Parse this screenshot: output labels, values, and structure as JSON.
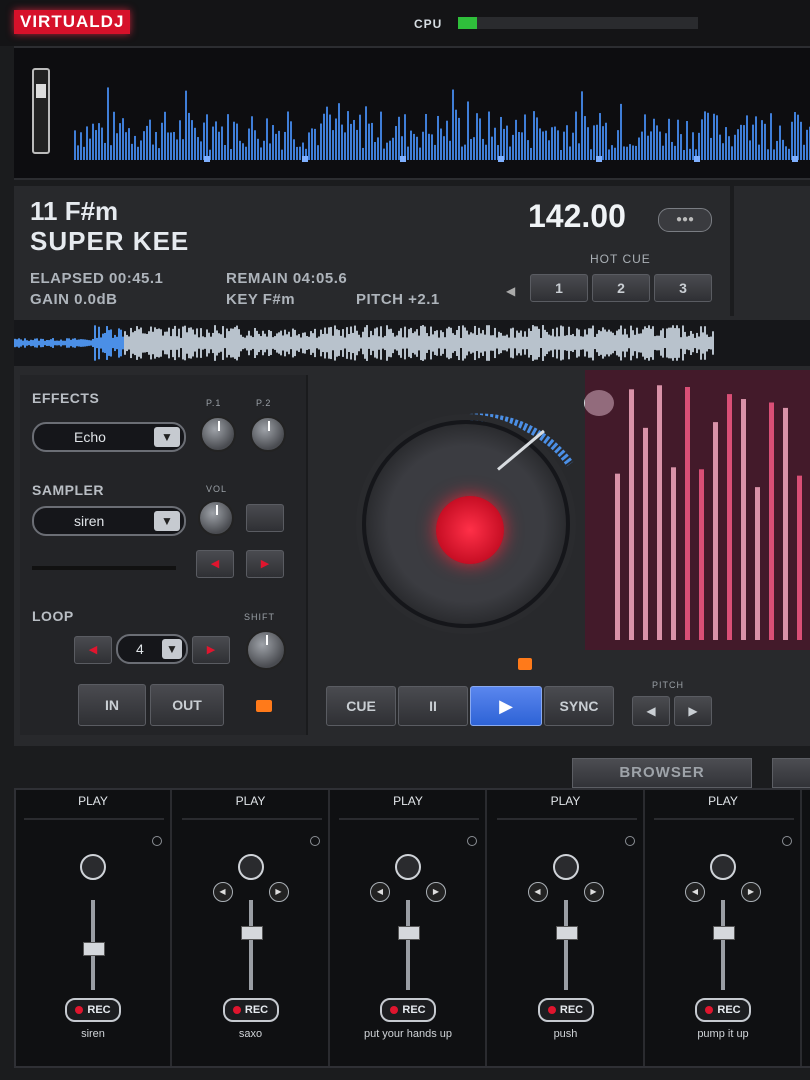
{
  "app": {
    "logo": "VIRTUALDJ"
  },
  "cpu": {
    "label": "CPU",
    "level": 0.08,
    "color": "#2fbf3b"
  },
  "deck": {
    "key_display": "11 F#m",
    "title": "SUPER KEE",
    "bpm": "142.00",
    "elapsed": "ELAPSED 00:45.1",
    "gain": "GAIN 0.0dB",
    "remain": "REMAIN 04:05.6",
    "key": "KEY F#m",
    "pitch": "PITCH +2.1",
    "hot_cue_label": "HOT CUE",
    "hot_cues": [
      "1",
      "2",
      "3"
    ]
  },
  "effects": {
    "label": "EFFECTS",
    "selected": "Echo",
    "knob_labels": [
      "P.1",
      "P.2"
    ]
  },
  "sampler_ctrl": {
    "label": "SAMPLER",
    "selected": "siren",
    "vol_label": "VOL"
  },
  "loop": {
    "label": "LOOP",
    "value": "4",
    "shift_label": "SHIFT",
    "in_label": "IN",
    "out_label": "OUT"
  },
  "transport": {
    "cue_label": "CUE",
    "pause_label": "II",
    "play_icon": "play-icon",
    "sync_label": "SYNC",
    "pitch_label": "PITCH"
  },
  "browser": {
    "label": "BROWSER"
  },
  "slots": [
    {
      "play_label": "PLAY",
      "rec_label": "REC",
      "name": "siren",
      "fader": 0.55
    },
    {
      "play_label": "PLAY",
      "rec_label": "REC",
      "name": "saxo",
      "fader": 0.75
    },
    {
      "play_label": "PLAY",
      "rec_label": "REC",
      "name": "put your hands up",
      "fader": 0.75
    },
    {
      "play_label": "PLAY",
      "rec_label": "REC",
      "name": "push",
      "fader": 0.75
    },
    {
      "play_label": "PLAY",
      "rec_label": "REC",
      "name": "pump it up",
      "fader": 0.75
    }
  ],
  "colors": {
    "accent": "#d6112a",
    "waveform": "#3f7ed8",
    "play_active": "#2e63d6"
  }
}
